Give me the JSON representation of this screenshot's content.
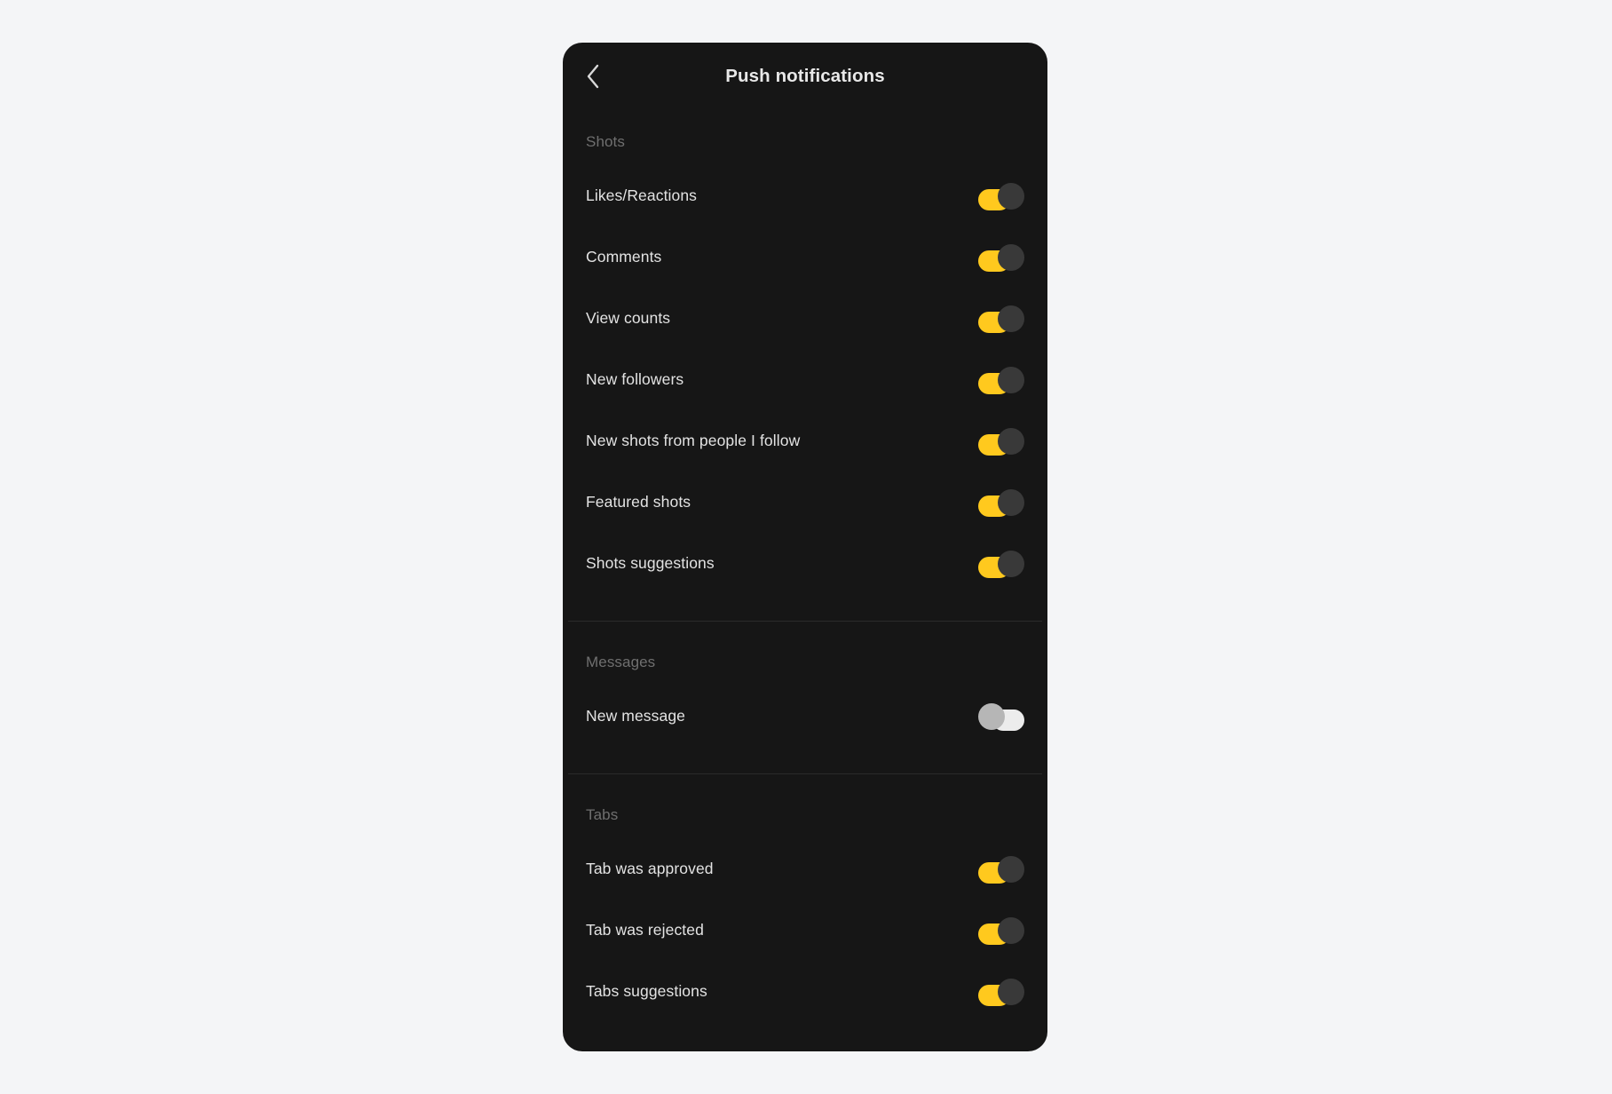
{
  "page": {
    "background_color": "#f4f5f7"
  },
  "card": {
    "background_color": "#161616"
  },
  "header": {
    "title": "Push notifications",
    "back_icon": "chevron-left-icon"
  },
  "colors": {
    "toggle_on_track": "#ffc91e",
    "toggle_on_knob": "#393939",
    "toggle_off_track": "#ececec",
    "toggle_off_knob": "#b6b6b6",
    "divider": "#2b2b2b",
    "label": "#e3e3e3",
    "section_header": "#6f6f6f"
  },
  "sections": [
    {
      "title": "Shots",
      "rows": [
        {
          "label": "Likes/Reactions",
          "state": "on"
        },
        {
          "label": "Comments",
          "state": "on"
        },
        {
          "label": "View counts",
          "state": "on"
        },
        {
          "label": "New followers",
          "state": "on"
        },
        {
          "label": "New shots from people I follow",
          "state": "on"
        },
        {
          "label": "Featured shots",
          "state": "on"
        },
        {
          "label": "Shots suggestions",
          "state": "on"
        }
      ]
    },
    {
      "title": "Messages",
      "rows": [
        {
          "label": "New message",
          "state": "off"
        }
      ]
    },
    {
      "title": "Tabs",
      "rows": [
        {
          "label": "Tab was approved",
          "state": "on"
        },
        {
          "label": "Tab was rejected",
          "state": "on"
        },
        {
          "label": "Tabs suggestions",
          "state": "on"
        }
      ]
    }
  ]
}
